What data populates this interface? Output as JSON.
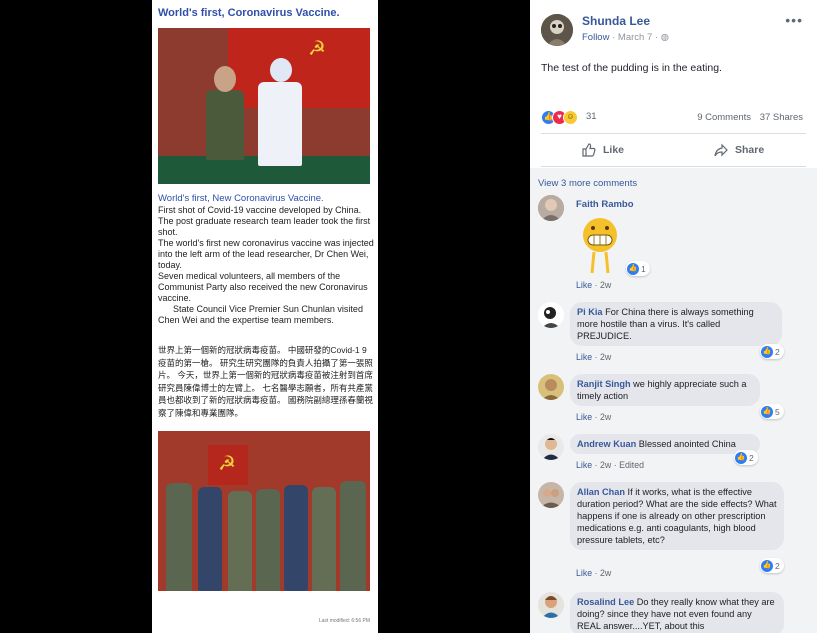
{
  "document": {
    "title": "World's first, Coronavirus Vaccine.",
    "subtitle": "World's first, New Coronavirus Vaccine.",
    "paragraphs": [
      "First shot of Covid-19 vaccine developed by China. The post graduate research team leader took the first shot.",
      "The world's first new coronavirus vaccine was injected into the left arm of the lead researcher, Dr Chen Wei, today.",
      "Seven medical volunteers, all members of the Communist Party also received the new Coronavirus vaccine.",
      "      State Council Vice Premier Sun Chunlan visited Chen Wei and the expertise team members."
    ],
    "chinese_text": "世界上第一個新的冠狀病毒疫苗。 中國研發的Covid-1 9疫苗的第一槍。 研究生研究團隊的負責人拍攝了第一張照片。 今天，世界上第一個新的冠狀病毒疫苗被注射到首席研究員陳偉博士的左臂上。 七名醫學志願者，所有共產黨員也都收到了新的冠狀病毒疫苗。 國務院副總理孫春蘭視察了陳偉和專業團隊。",
    "footer": "Last modified: 6:56 PM"
  },
  "post": {
    "author": "Shunda Lee",
    "follow": "Follow",
    "date": "March 7",
    "separator": "·",
    "more": "•••",
    "text": "The test of the pudding is in the eating.",
    "reaction_count": "31",
    "comments_count": "9 Comments",
    "shares_count": "37 Shares",
    "like_label": "Like",
    "share_label": "Share",
    "view_more": "View 3 more comments"
  },
  "comments": [
    {
      "name": "Faith Rambo",
      "text": "",
      "time": "2w",
      "likes": "1",
      "edited": ""
    },
    {
      "name": "Pi Kia",
      "text": "For China there is always something more hostile than a virus. It's called PREJUDICE.",
      "time": "2w",
      "likes": "2",
      "edited": ""
    },
    {
      "name": "Ranjit Singh",
      "text": "we highly appreciate such a timely action",
      "time": "2w",
      "likes": "5",
      "edited": ""
    },
    {
      "name": "Andrew Kuan",
      "text": "Blessed anointed China",
      "time": "2w",
      "likes": "2",
      "edited": "Edited"
    },
    {
      "name": "Allan Chan",
      "text": "If it works, what is the effective duration period? What are the side effects? What happens if one is already on other prescription medications e.g. anti coagulants, high blood pressure tablets, etc?",
      "time": "2w",
      "likes": "2",
      "edited": ""
    },
    {
      "name": "Rosalind Lee",
      "text": "Do they really know what they are doing? since they have not even found any REAL answer....YET, about this",
      "time": "",
      "likes": "",
      "edited": ""
    }
  ],
  "labels": {
    "comment_like": "Like",
    "dot": "·"
  },
  "colors": {
    "link": "#385898",
    "like_blue": "#2e7cf6",
    "love_red": "#f0284a",
    "haha_yellow": "#f7c933",
    "doc_title_blue": "#2f4fa8"
  }
}
